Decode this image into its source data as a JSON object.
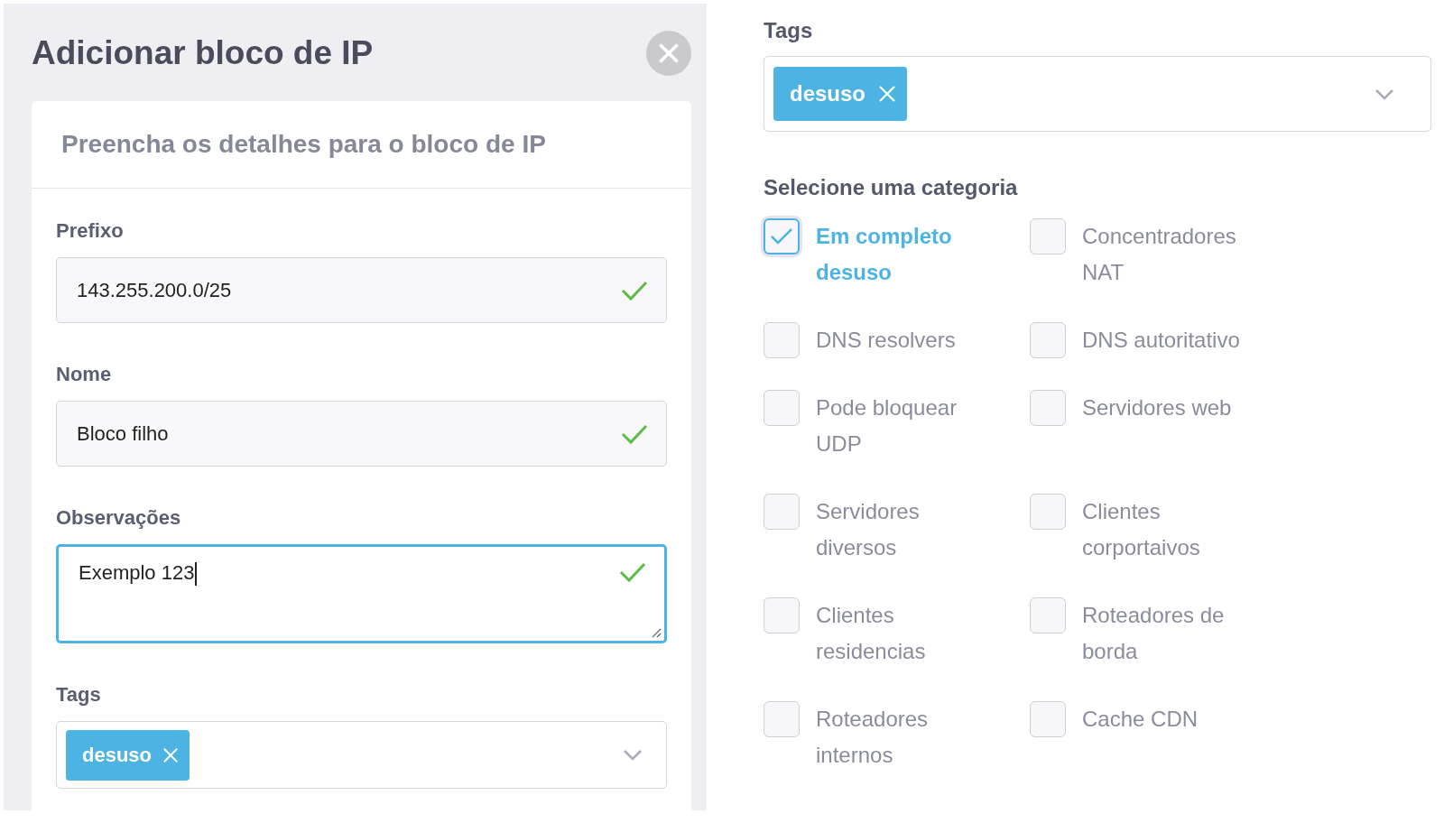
{
  "dialog": {
    "title": "Adicionar bloco de IP",
    "subtitle": "Preencha os detalhes para o bloco de IP",
    "fields": [
      {
        "kind": "input",
        "label": "Prefixo",
        "value": "143.255.200.0/25",
        "valid": true,
        "focused": false
      },
      {
        "kind": "input",
        "label": "Nome",
        "value": "Bloco filho",
        "valid": true,
        "focused": false
      },
      {
        "kind": "textarea",
        "label": "Observações",
        "value": "Exemplo 123",
        "valid": true,
        "focused": true
      },
      {
        "kind": "tags",
        "label": "Tags",
        "tags": [
          "desuso"
        ]
      }
    ]
  },
  "side": {
    "tags_label": "Tags",
    "tags": [
      "desuso"
    ],
    "category_label": "Selecione uma categoria",
    "categories": [
      {
        "label": "Em completo desuso",
        "checked": true
      },
      {
        "label": "Concentradores NAT",
        "checked": false
      },
      {
        "label": "DNS resolvers",
        "checked": false
      },
      {
        "label": "DNS autoritativo",
        "checked": false
      },
      {
        "label": "Pode bloquear UDP",
        "checked": false
      },
      {
        "label": "Servidores web",
        "checked": false
      },
      {
        "label": "Servidores diversos",
        "checked": false
      },
      {
        "label": "Clientes corportaivos",
        "checked": false
      },
      {
        "label": "Clientes residencias",
        "checked": false
      },
      {
        "label": "Roteadores de borda",
        "checked": false
      },
      {
        "label": "Roteadores internos",
        "checked": false
      },
      {
        "label": "Cache CDN",
        "checked": false
      }
    ]
  }
}
